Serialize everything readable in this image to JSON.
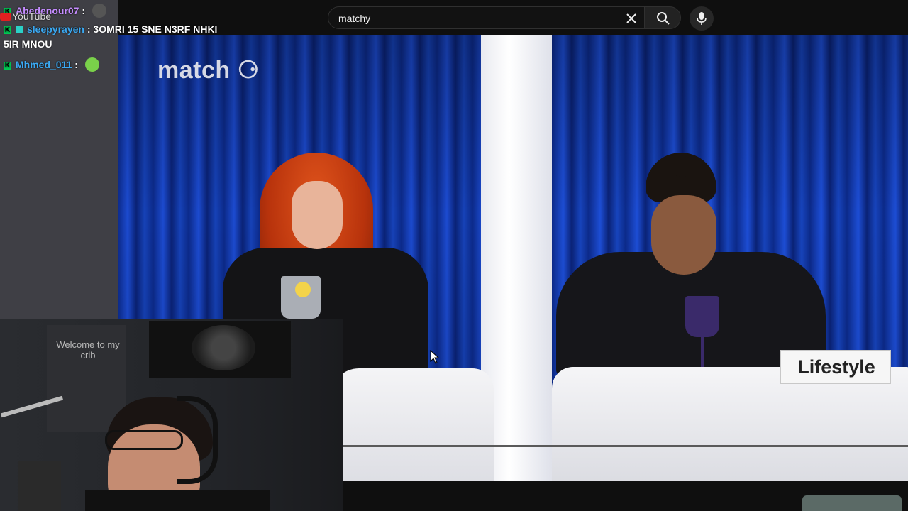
{
  "search": {
    "query": "matchy"
  },
  "chat": {
    "messages": [
      {
        "user": "Abedenour07",
        "text": ""
      },
      {
        "user": "sleepyrayen",
        "text": "3OMRI 15 SNE N3RF NHKI"
      },
      {
        "user": "",
        "text": "5IR MNOU"
      },
      {
        "user": "Mhmed_011",
        "text": ""
      }
    ],
    "platform_label": "YouTube"
  },
  "video": {
    "logo_text": "match",
    "placard_text": "Lifestyle"
  },
  "webcam": {
    "poster_text": "Welcome to my crib"
  },
  "colors": {
    "curtain_blue": "#1c4bd0",
    "hair_red": "#d24a1a",
    "chat_name_purple": "#c58cff",
    "chat_name_cyan": "#3ba9f3",
    "badge_green": "#00c853"
  }
}
